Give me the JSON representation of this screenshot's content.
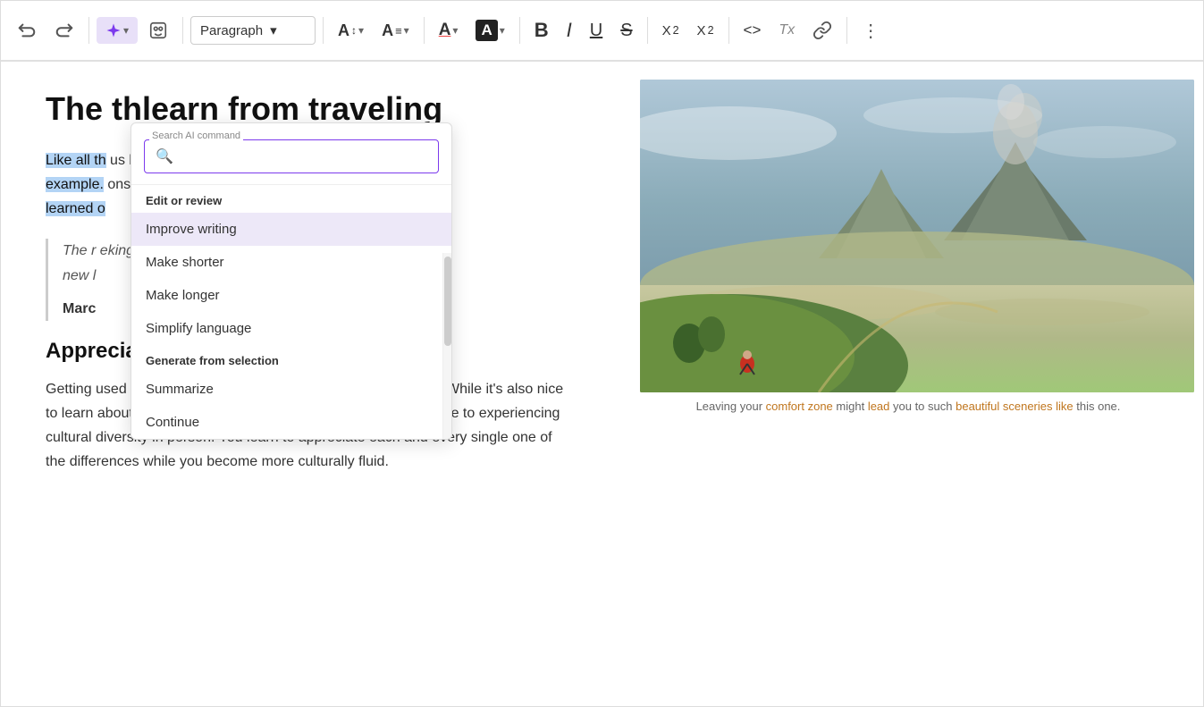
{
  "toolbar": {
    "undo_btn": "↩",
    "redo_btn": "↪",
    "ai_btn": "✦",
    "ai_chevron": "▾",
    "ai_assistant_icon": "🤖",
    "paragraph_label": "Paragraph",
    "paragraph_chevron": "▾",
    "font_size_icon": "A↕",
    "font_size_chevron": "▾",
    "font_size2_icon": "A≡",
    "font_size2_chevron": "▾",
    "font_color_icon": "A",
    "font_color_chevron": "▾",
    "highlight_icon": "A",
    "highlight_chevron": "▾",
    "bold_label": "B",
    "italic_label": "I",
    "underline_label": "U",
    "strikethrough_label": "S",
    "subscript_label": "X₂",
    "superscript_label": "X²",
    "code_label": "<>",
    "clear_format_label": "Tx",
    "link_label": "🔗",
    "more_label": "⋮"
  },
  "ai_dropdown": {
    "search_label": "Search AI command",
    "search_placeholder": "",
    "sections": [
      {
        "label": "Edit or review",
        "items": [
          {
            "text": "Improve writing",
            "active": true
          },
          {
            "text": "Make shorter",
            "active": false
          },
          {
            "text": "Make longer",
            "active": false
          },
          {
            "text": "Simplify language",
            "active": false
          }
        ]
      },
      {
        "label": "Generate from selection",
        "items": [
          {
            "text": "Summarize",
            "active": false
          },
          {
            "text": "Continue",
            "active": false
          }
        ]
      }
    ]
  },
  "article": {
    "title_start": "The th",
    "title_end": "learn from traveling",
    "body_highlighted": "Like all th",
    "body_highlighted2": "example.",
    "body_highlighted3": "learned o",
    "body_suffix": "us by",
    "body_suffix2": "ons I've",
    "blockquote_line1": "The r",
    "blockquote_suffix1": "eking",
    "blockquote_line2": "new l",
    "author": "Marc",
    "section_title": "Appreciation of diversity",
    "section_body": "Getting used to an entirely different culture can be challenging. While it's also nice to learn about cultures online or from books, nothing comes close to experiencing cultural diversity in person. You learn to appreciate each and every single one of the differences while you become more culturally fluid.",
    "image_caption": "Leaving your comfort zone might lead you to such beautiful sceneries like this one."
  }
}
